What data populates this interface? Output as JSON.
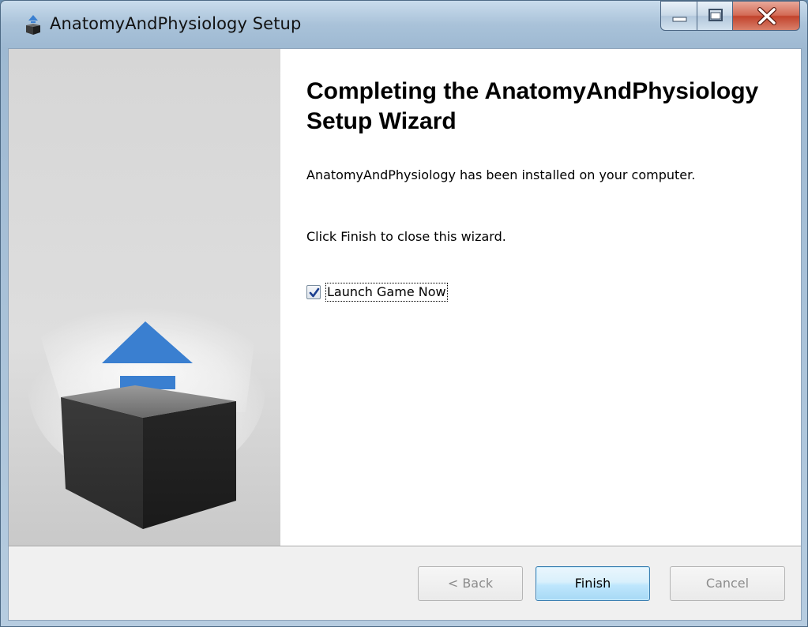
{
  "window": {
    "title": "AnatomyAndPhysiology Setup",
    "controls": {
      "minimize_icon": "minimize-icon",
      "maximize_icon": "maximize-icon",
      "close_icon": "close-icon"
    }
  },
  "wizard": {
    "heading": "Completing the AnatomyAndPhysiology Setup Wizard",
    "installed_text": "AnatomyAndPhysiology has been installed on your computer.",
    "finish_hint": "Click Finish to close this wizard.",
    "launch_checkbox": {
      "label": "Launch Game Now",
      "checked": true
    }
  },
  "buttons": {
    "back": "< Back",
    "finish": "Finish",
    "cancel": "Cancel"
  },
  "colors": {
    "accent_blue": "#3a7fd0",
    "box_dark": "#2e2e2e",
    "finish_border": "#3c7fb1"
  }
}
